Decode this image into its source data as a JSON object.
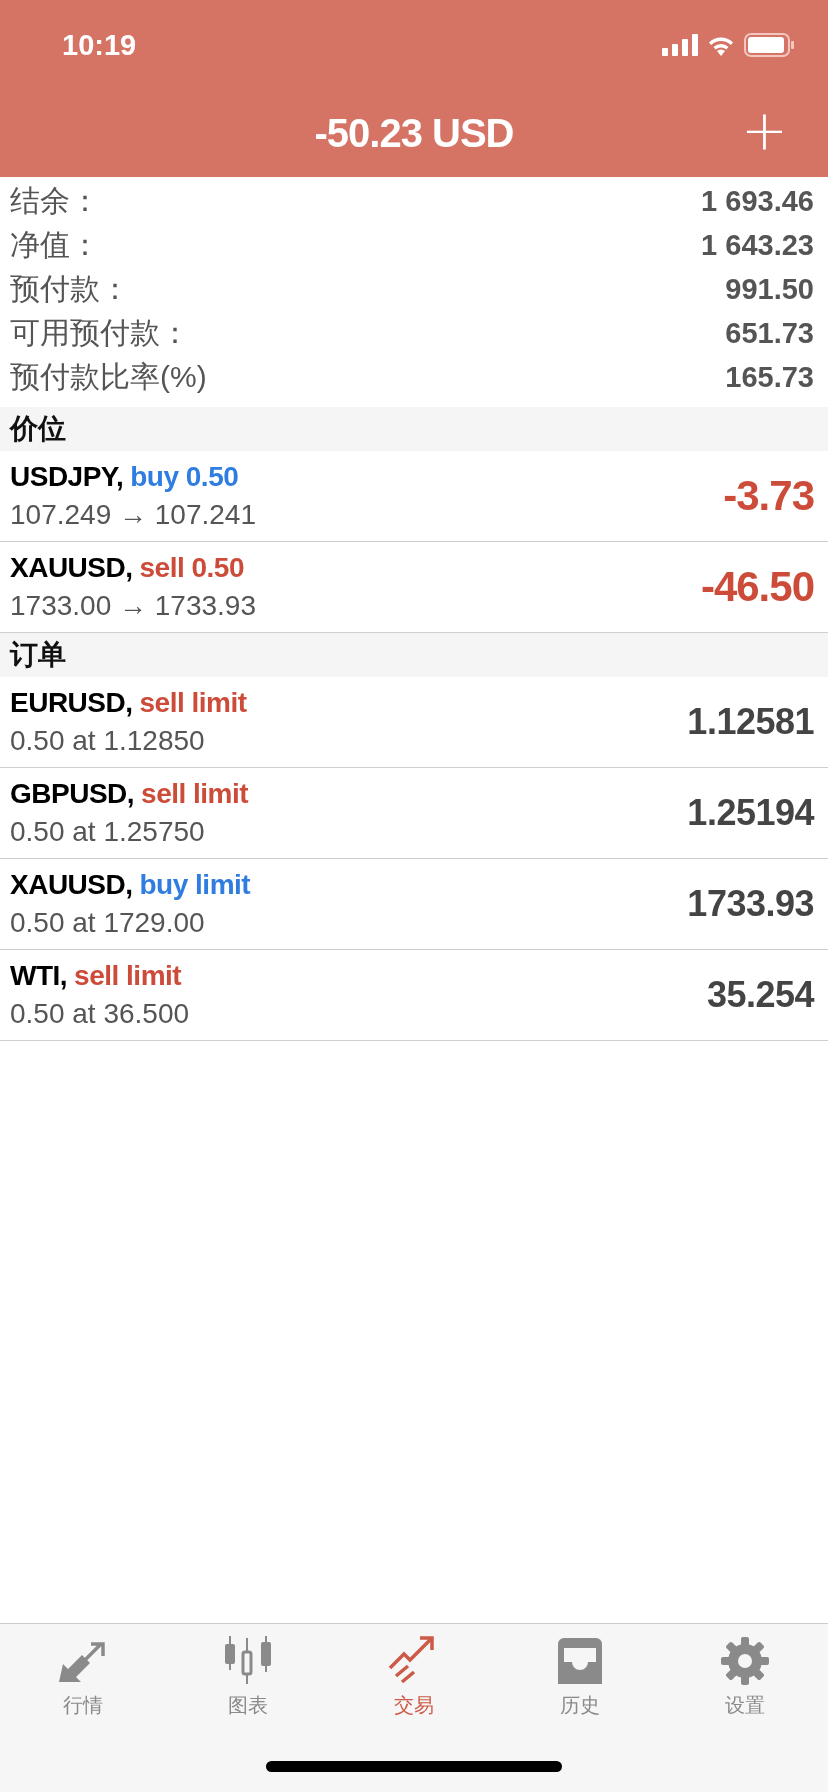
{
  "status_bar": {
    "time": "10:19"
  },
  "header": {
    "title": "-50.23 USD",
    "add_button": "+"
  },
  "account": [
    {
      "label": "结余：",
      "value": "1 693.46"
    },
    {
      "label": "净值：",
      "value": "1 643.23"
    },
    {
      "label": "预付款：",
      "value": "991.50"
    },
    {
      "label": "可用预付款：",
      "value": "651.73"
    },
    {
      "label": "预付款比率(%)",
      "value": "165.73"
    }
  ],
  "positions": {
    "title": "价位",
    "rows": [
      {
        "symbol": "USDJPY,",
        "kind": "buy",
        "action": "buy 0.50",
        "prices": "107.249 → 107.241",
        "profit": "-3.73"
      },
      {
        "symbol": "XAUUSD,",
        "kind": "sell",
        "action": "sell 0.50",
        "prices": "1733.00 → 1733.93",
        "profit": "-46.50"
      }
    ]
  },
  "orders": {
    "title": "订单",
    "rows": [
      {
        "symbol": "EURUSD,",
        "kind": "sell",
        "action": "sell limit",
        "detail": "0.50 at 1.12850",
        "price": "1.12581"
      },
      {
        "symbol": "GBPUSD,",
        "kind": "sell",
        "action": "sell limit",
        "detail": "0.50 at 1.25750",
        "price": "1.25194"
      },
      {
        "symbol": "XAUUSD,",
        "kind": "buy",
        "action": "buy limit",
        "detail": "0.50 at 1729.00",
        "price": "1733.93"
      },
      {
        "symbol": "WTI,",
        "kind": "sell",
        "action": "sell limit",
        "detail": "0.50 at 36.500",
        "price": "35.254"
      }
    ]
  },
  "tabs": [
    {
      "kind": "quotes",
      "label": "行情",
      "selected": false
    },
    {
      "kind": "chart",
      "label": "图表",
      "selected": false
    },
    {
      "kind": "trade",
      "label": "交易",
      "selected": true
    },
    {
      "kind": "history",
      "label": "历史",
      "selected": false
    },
    {
      "kind": "settings",
      "label": "设置",
      "selected": false
    }
  ]
}
